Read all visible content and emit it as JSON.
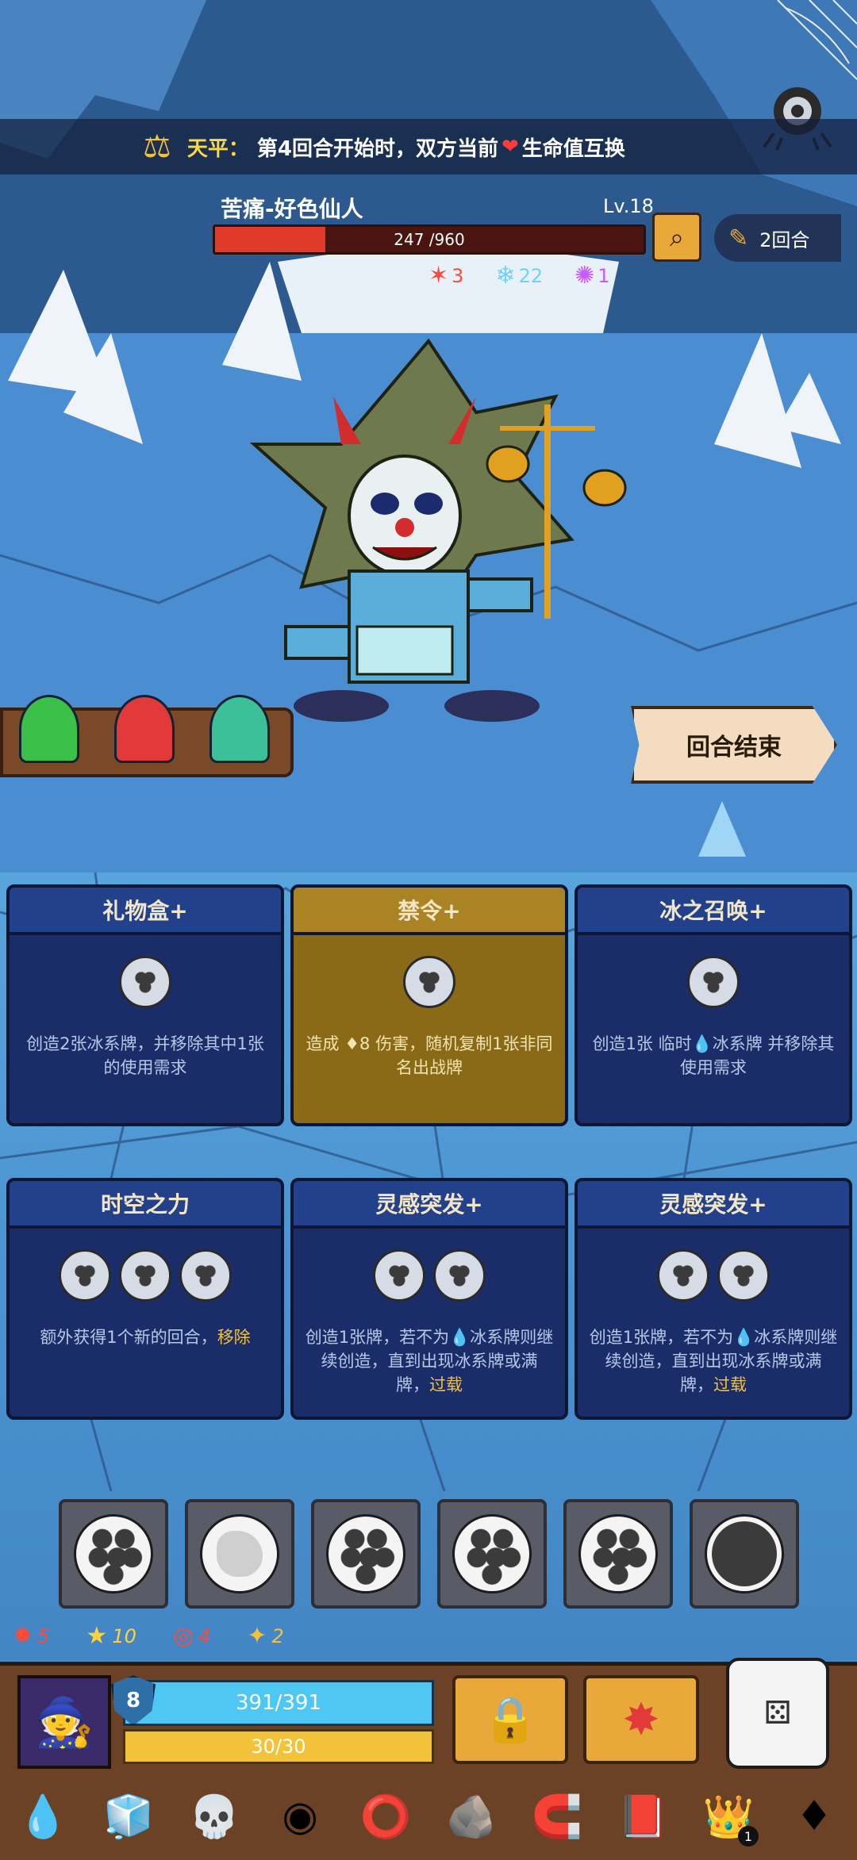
{
  "banner": {
    "label": "天平：",
    "text": "第4回合开始时，双方当前",
    "tail": "生命值互换"
  },
  "boss": {
    "name": "苦痛-好色仙人",
    "level": "Lv.18",
    "hp_text": "247 /960",
    "hp_fraction": 0.257,
    "statuses": [
      {
        "icon": "burn-icon",
        "value": "3",
        "color": "#ff4a3a",
        "glyph": "✶"
      },
      {
        "icon": "frost-icon",
        "value": "22",
        "color": "#6fd0ff",
        "glyph": "❄"
      },
      {
        "icon": "poison-icon",
        "value": "1",
        "color": "#c65cff",
        "glyph": "✺"
      }
    ]
  },
  "round_counter": "2回合",
  "end_turn_label": "回合结束",
  "cards": [
    {
      "title": "礼物盒+",
      "costs": 1,
      "gold": false,
      "desc": "创造2张冰系牌，并移除其中1张的使用需求"
    },
    {
      "title": "禁令+",
      "costs": 1,
      "gold": true,
      "desc": "造成 ♦8 伤害，随机复制1张非同名出战牌"
    },
    {
      "title": "冰之召唤+",
      "costs": 1,
      "gold": false,
      "desc": "创造1张 临时💧冰系牌 并移除其使用需求"
    },
    {
      "title": "时空之力",
      "costs": 3,
      "gold": false,
      "desc": "额外获得1个新的回合，",
      "highlight": "移除"
    },
    {
      "title": "灵感突发+",
      "costs": 2,
      "gold": false,
      "desc": "创造1张牌，若不为💧冰系牌则继续创造，直到出现冰系牌或满牌，",
      "highlight": "过载"
    },
    {
      "title": "灵感突发+",
      "costs": 2,
      "gold": false,
      "desc": "创造1张牌，若不为💧冰系牌则继续创造，直到出现冰系牌或满牌，",
      "highlight": "过载"
    }
  ],
  "dice_slots": [
    "cluster-die",
    "blank-die",
    "cluster-die",
    "cluster-die",
    "cluster-die",
    "dark-die"
  ],
  "player_stats": [
    {
      "icon": "burn-stat-icon",
      "value": "5",
      "color": "#ff4a3a",
      "glyph": "✹"
    },
    {
      "icon": "star-stat-icon",
      "value": "10",
      "color": "#ffd23a",
      "glyph": "★"
    },
    {
      "icon": "spiral-stat-icon",
      "value": "4",
      "color": "#ff4a3a",
      "glyph": "◎"
    },
    {
      "icon": "gear-stat-icon",
      "value": "2",
      "color": "#f2c23a",
      "glyph": "✦"
    }
  ],
  "player": {
    "armor": "8",
    "hp_text": "391/391",
    "energy_text": "30/30"
  },
  "relics": [
    {
      "name": "water-drop-relic-icon",
      "glyph": "💧"
    },
    {
      "name": "ice-crystal-relic-icon",
      "glyph": "🧊"
    },
    {
      "name": "frost-skull-relic-icon",
      "glyph": "💀"
    },
    {
      "name": "fire-ring-relic-icon",
      "glyph": "◉"
    },
    {
      "name": "bracelet-relic-icon",
      "glyph": "⭕"
    },
    {
      "name": "stone-relic-icon",
      "glyph": "🪨"
    },
    {
      "name": "horseshoe-relic-icon",
      "glyph": "🧲"
    },
    {
      "name": "spellbook-relic-icon",
      "glyph": "📕"
    },
    {
      "name": "treasure-relic-icon",
      "glyph": "👑",
      "badge": "1"
    },
    {
      "name": "ruby-relic-icon",
      "glyph": "♦"
    }
  ]
}
